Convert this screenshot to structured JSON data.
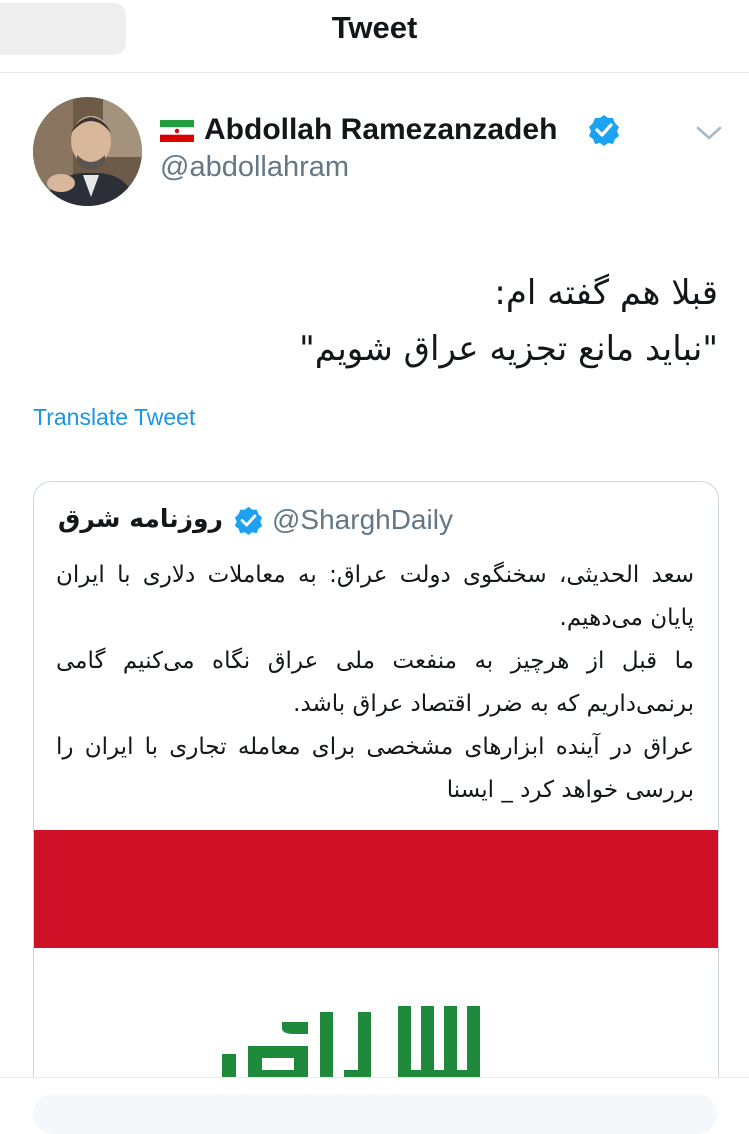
{
  "nav": {
    "title": "Tweet",
    "back_icon": "back-arrow-icon"
  },
  "tweet": {
    "author_name": "Abdollah Ramezanzadeh",
    "handle": "@abdollahram",
    "flag_icon": "iran-flag-icon",
    "verified_icon": "verified-badge-icon",
    "menu_icon": "chevron-down-icon",
    "text_line1": "قبلا هم گفته ام:",
    "text_line2": "\"نباید مانع تجزیه عراق شویم\"",
    "translate_label": "Translate Tweet"
  },
  "quote": {
    "name": "روزنامه شرق",
    "handle": "@SharghDaily",
    "text": "سعد الحدیثی، سخنگوی دولت عراق: به معاملات دلاری با ایران پایان می‌دهیم.\nما قبل از هرچیز به منفعت ملی عراق نگاه می‌کنیم گامی برنمی‌داریم که به ضرر اقتصاد عراق باشد.\nعراق در آینده ابزارهای مشخصی برای معامله تجاری با ایران را بررسی خواهد کرد _ ایسنا",
    "image": {
      "description_icon": "iraq-flag-image",
      "red": "#ce1126",
      "white": "#ffffff",
      "green": "#1f8a3c"
    }
  },
  "colors": {
    "link": "#1b95e0",
    "verified": "#1da1f2",
    "secondary": "#657786",
    "border": "#ccd6dd"
  }
}
